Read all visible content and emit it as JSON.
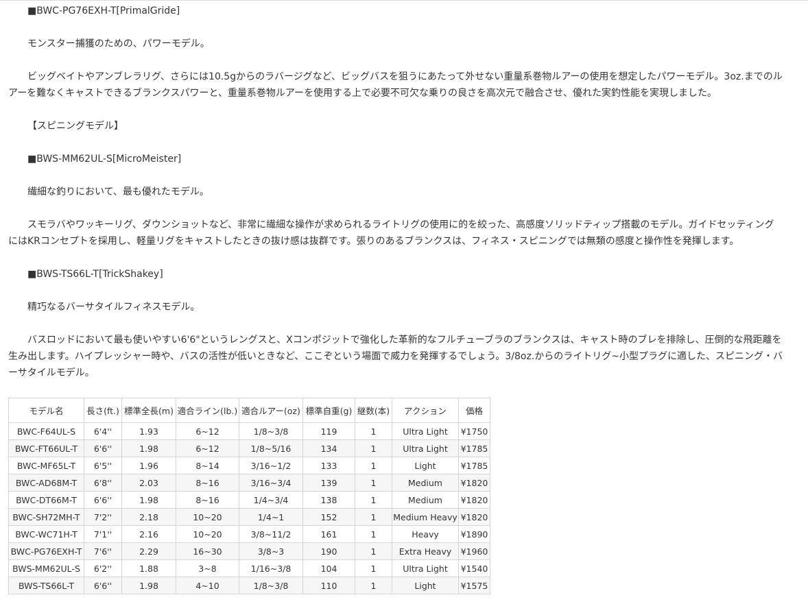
{
  "paragraphs": [
    "■BWC-PG76EXH-T[PrimalGride]",
    "モンスター捕獲のための、パワーモデル。",
    "ビッグベイトやアンブレラリグ、さらには10.5gからのラバージグなど、ビッグバスを狙うにあたって外せない重量系巻物ルアーの使用を想定したパワーモデル。3oz.までのルアーを難なくキャストできるブランクスパワーと、重量系巻物ルアーを使用する上で必要不可欠な乗りの良さを高次元で融合させ、優れた実釣性能を実現しました。",
    "【スピニングモデル】",
    "■BWS-MM62UL-S[MicroMeister]",
    "繊細な釣りにおいて、最も優れたモデル。",
    "スモラバやワッキーリグ、ダウンショットなど、非常に繊細な操作が求められるライトリグの使用に的を絞った、高感度ソリッドティップ搭載のモデル。ガイドセッティングにはKRコンセプトを採用し、軽量リグをキャストしたときの抜け感は抜群です。張りのあるブランクスは、フィネス・スピニングでは無類の感度と操作性を発揮します。",
    "■BWS-TS66L-T[TrickShakey]",
    "精巧なるバーサタイルフィネスモデル。",
    "バスロッドにおいて最も使いやすい6'6\"というレングスと、Xコンポジットで強化した革新的なフルチューブラのブランクスは、キャスト時のブレを排除し、圧倒的な飛距離を生み出します。ハイプレッシャー時や、バスの活性が低いときなど、ここぞという場面で威力を発揮するでしょう。3/8oz.からのライトリグ~小型プラグに適した、スピニング・バーサタイルモデル。"
  ],
  "table": {
    "headers": [
      "モデル名",
      "長さ(ft.)",
      "標準全長(m)",
      "適合ライン(lb.)",
      "適合ルアー(oz)",
      "標準自重(g)",
      "継数(本)",
      "アクション",
      "価格"
    ],
    "rows": [
      [
        "BWC-F64UL-S",
        "6'4''",
        "1.93",
        "6~12",
        "1/8~3/8",
        "119",
        "1",
        "Ultra Light",
        "¥1750"
      ],
      [
        "BWC-FT66UL-T",
        "6'6''",
        "1.98",
        "6~12",
        "1/8~5/16",
        "134",
        "1",
        "Ultra Light",
        "¥1785"
      ],
      [
        "BWC-MF65L-T",
        "6'5''",
        "1.96",
        "8~14",
        "3/16~1/2",
        "133",
        "1",
        "Light",
        "¥1785"
      ],
      [
        "BWC-AD68M-T",
        "6'8''",
        "2.03",
        "8~16",
        "3/16~3/4",
        "139",
        "1",
        "Medium",
        "¥1820"
      ],
      [
        "BWC-DT66M-T",
        "6'6''",
        "1.98",
        "8~16",
        "1/4~3/4",
        "138",
        "1",
        "Medium",
        "¥1820"
      ],
      [
        "BWC-SH72MH-T",
        "7'2''",
        "2.18",
        "10~20",
        "1/4~1",
        "152",
        "1",
        "Medium Heavy",
        "¥1820"
      ],
      [
        "BWC-WC71H-T",
        "7'1''",
        "2.16",
        "10~20",
        "3/8~11/2",
        "161",
        "1",
        "Heavy",
        "¥1890"
      ],
      [
        "BWC-PG76EXH-T",
        "7'6''",
        "2.29",
        "16~30",
        "3/8~3",
        "190",
        "1",
        "Extra Heavy",
        "¥1960"
      ],
      [
        "BWS-MM62UL-S",
        "6'2''",
        "1.88",
        "3~8",
        "1/16~3/8",
        "104",
        "1",
        "Ultra Light",
        "¥1540"
      ],
      [
        "BWS-TS66L-T",
        "6'6''",
        "1.98",
        "4~10",
        "1/8~3/8",
        "110",
        "1",
        "Light",
        "¥1575"
      ]
    ]
  }
}
